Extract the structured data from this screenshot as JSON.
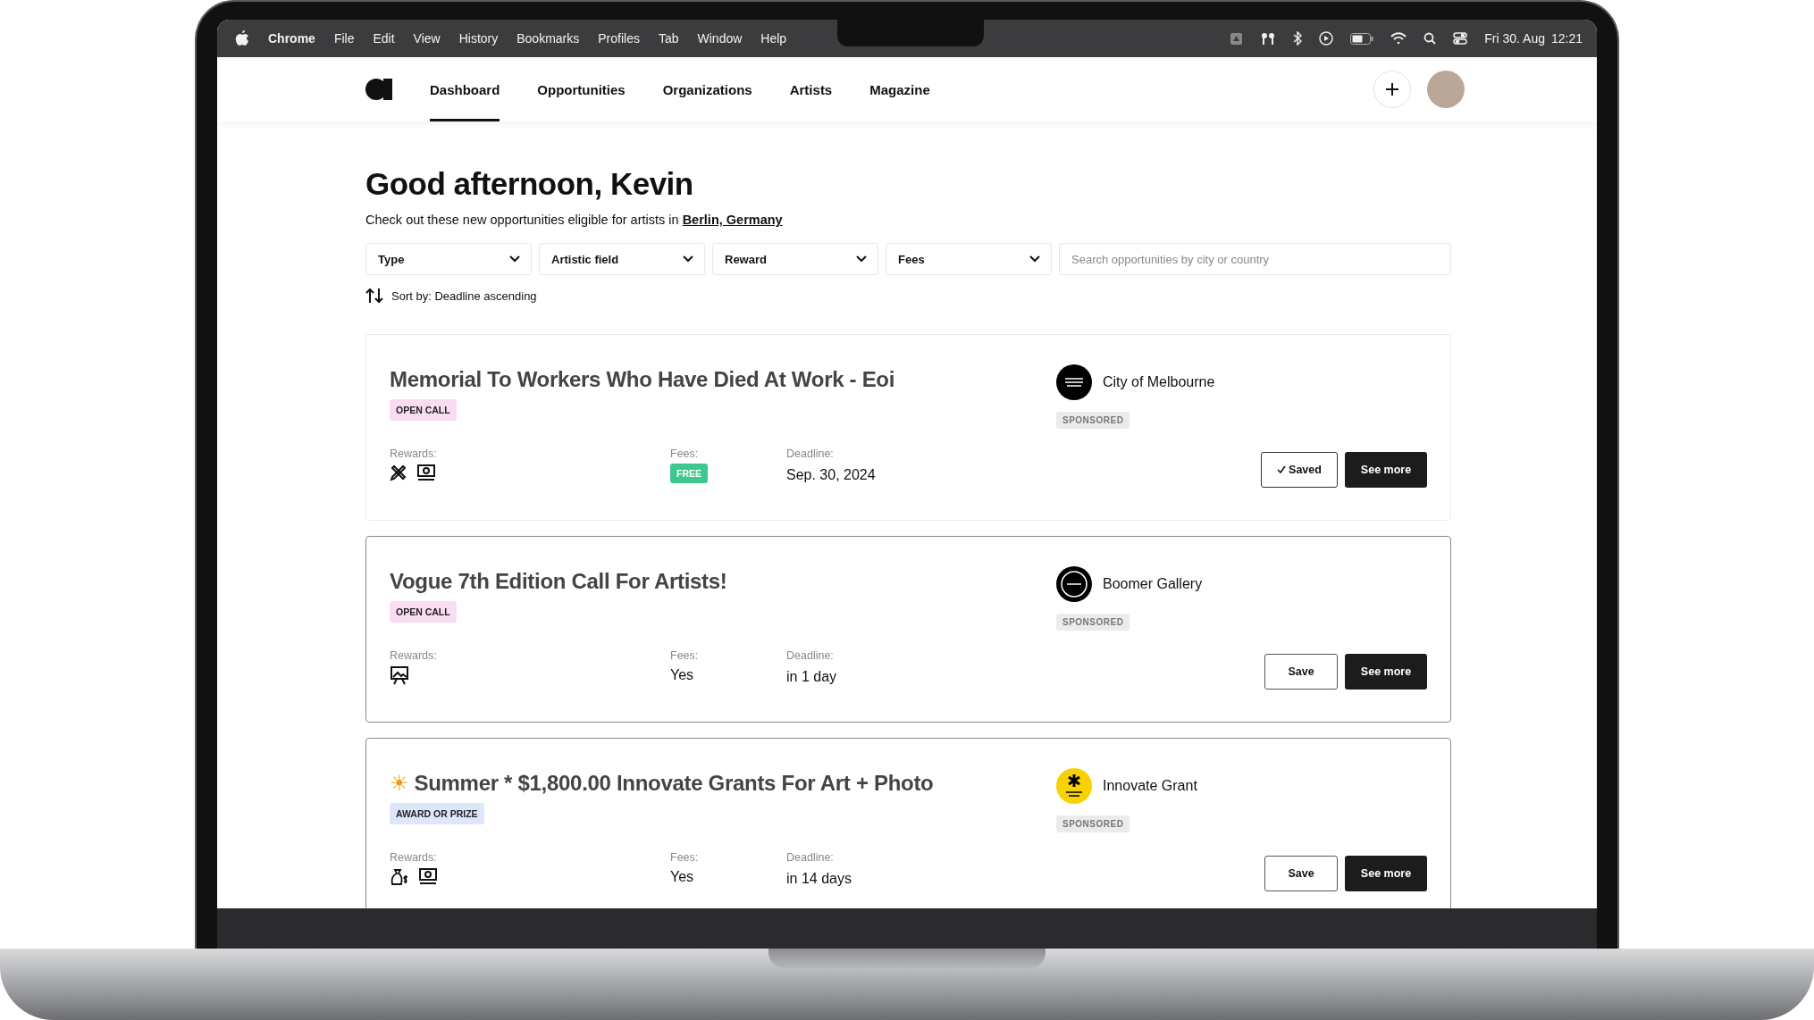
{
  "menubar": {
    "app": "Chrome",
    "menus": [
      "File",
      "Edit",
      "View",
      "History",
      "Bookmarks",
      "Profiles",
      "Tab",
      "Window",
      "Help"
    ],
    "date": "Fri 30. Aug",
    "time": "12:21"
  },
  "nav": {
    "tabs": [
      {
        "label": "Dashboard",
        "selected": true
      },
      {
        "label": "Opportunities",
        "selected": false
      },
      {
        "label": "Organizations",
        "selected": false
      },
      {
        "label": "Artists",
        "selected": false
      },
      {
        "label": "Magazine",
        "selected": false
      }
    ]
  },
  "greeting": "Good afternoon, Kevin",
  "subtitle": {
    "text": "Check out these new opportunities eligible for artists in",
    "link": "Berlin, Germany"
  },
  "filters": [
    "Type",
    "Artistic field",
    "Reward",
    "Fees"
  ],
  "search": {
    "placeholder": "Search opportunities by city or country"
  },
  "sort": "Sort by: Deadline ascending",
  "cards": [
    {
      "title": "Memorial To Workers Who Have Died At Work - Eoi",
      "tag": {
        "text": "OPEN CALL",
        "color": "#f9dcf1"
      },
      "highlighted": false,
      "rewards_label": "Rewards:",
      "rewards": [
        {
          "kind": "tools"
        },
        {
          "kind": "money"
        }
      ],
      "fees_label": "Fees:",
      "fees": {
        "kind": "badge",
        "text": "FREE"
      },
      "deadline_label": "Deadline:",
      "deadline": "Sep. 30, 2024",
      "org": "City of Melbourne",
      "logo": {
        "kind": "lines"
      },
      "sponsored": "SPONSORED",
      "saved": true,
      "save_label": "Saved",
      "more": "See more"
    },
    {
      "title": "Vogue 7th Edition Call For Artists!",
      "tag": {
        "text": "OPEN CALL",
        "color": "#f9dcf1"
      },
      "highlighted": true,
      "rewards_label": "Rewards:",
      "rewards": [
        {
          "kind": "exhibition"
        }
      ],
      "fees_label": "Fees:",
      "fees": {
        "kind": "plain",
        "text": "Yes"
      },
      "deadline_label": "Deadline:",
      "deadline": "in 1 day",
      "org": "Boomer Gallery",
      "logo": {
        "kind": "ring"
      },
      "sponsored": "SPONSORED",
      "saved": false,
      "save_label": "Save",
      "more": "See more"
    },
    {
      "icon": "☀",
      "title": "Summer * $1,800.00 Innovate Grants For Art + Photo",
      "tag": {
        "text": "AWARD OR PRIZE",
        "color": "#dde6fb"
      },
      "highlighted": true,
      "rewards_label": "Rewards:",
      "rewards": [
        {
          "kind": "grant"
        },
        {
          "kind": "money"
        }
      ],
      "fees_label": "Fees:",
      "fees": {
        "kind": "plain",
        "text": "Yes"
      },
      "deadline_label": "Deadline:",
      "deadline": "in 14 days",
      "org": "Innovate Grant",
      "logo": {
        "kind": "asterisk"
      },
      "sponsored": "SPONSORED",
      "saved": false,
      "save_label": "Save",
      "more": "See more"
    }
  ]
}
